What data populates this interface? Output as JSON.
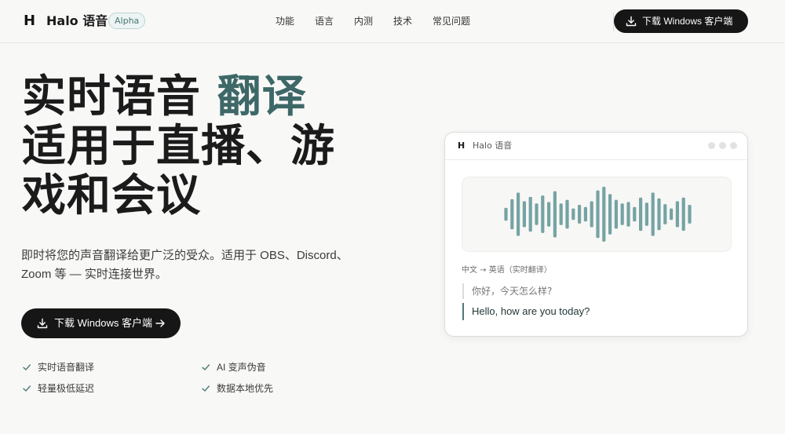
{
  "header": {
    "logo_mark": "H",
    "brand": "Halo 语音",
    "badge": "Alpha",
    "nav": [
      "功能",
      "语言",
      "内测",
      "技术",
      "常见问题"
    ],
    "download_label": "下载 Windows 客户端"
  },
  "hero": {
    "title_line1": "实时语音",
    "title_accent": "翻译",
    "title_line2": "适用于直播、游",
    "title_line3": "戏和会议",
    "subtitle_line1": "即时将您的声音翻译给更广泛的受众。适用于 OBS、Discord、",
    "subtitle_line2": "Zoom 等 — 实时连接世界。",
    "cta_label": "下载 Windows 客户端",
    "features": [
      "实时语音翻译",
      "AI 变声伪音",
      "轻量极低延迟",
      "数据本地优先"
    ]
  },
  "demo": {
    "window_logo": "H",
    "window_title": "Halo 语音",
    "lang_pair": "中文 → 英语（实时翻译）",
    "source_text": "你好，今天怎么样?",
    "translated_text": "Hello, how are you today?",
    "waveform_levels": [
      0.18,
      0.42,
      0.6,
      0.36,
      0.48,
      0.3,
      0.52,
      0.34,
      0.64,
      0.3,
      0.4,
      0.16,
      0.26,
      0.2,
      0.36,
      0.66,
      0.76,
      0.56,
      0.4,
      0.3,
      0.34,
      0.2,
      0.46,
      0.32,
      0.6,
      0.44,
      0.28,
      0.16,
      0.36,
      0.46,
      0.26
    ],
    "waveform_color": "#76a3a3"
  },
  "colors": {
    "accent": "#3e6868",
    "dark_button": "#161616",
    "background": "#f8f8f7"
  }
}
